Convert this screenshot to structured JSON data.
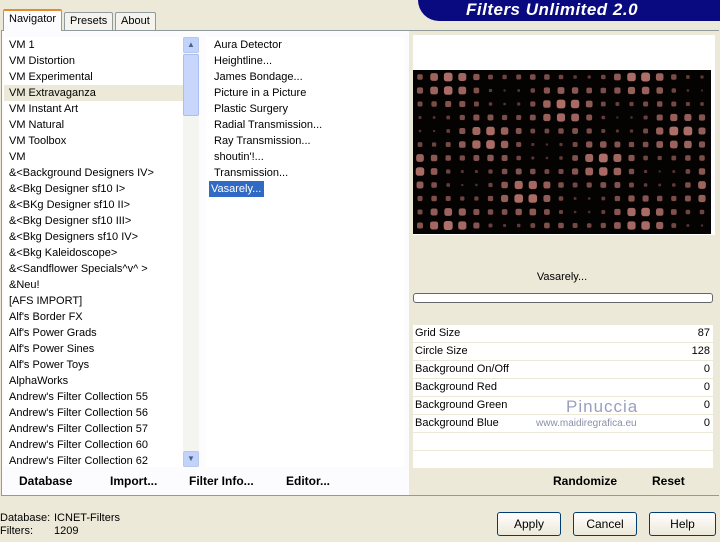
{
  "app_title": "Filters Unlimited 2.0",
  "tabs": [
    "Navigator",
    "Presets",
    "About"
  ],
  "categories": [
    "VM 1",
    "VM Distortion",
    "VM Experimental",
    "VM Extravaganza",
    "VM Instant Art",
    "VM Natural",
    "VM Toolbox",
    "VM",
    "&<Background Designers IV>",
    "&<Bkg Designer sf10 I>",
    "&<BKg Designer sf10 II>",
    "&<Bkg Designer sf10 III>",
    "&<Bkg Designers sf10 IV>",
    "&<Bkg Kaleidoscope>",
    "&<Sandflower Specials^v^ >",
    "&Neu!",
    "[AFS IMPORT]",
    "Alf's Border FX",
    "Alf's Power Grads",
    "Alf's Power Sines",
    "Alf's Power Toys",
    "AlphaWorks",
    "Andrew's Filter Collection 55",
    "Andrew's Filter Collection 56",
    "Andrew's Filter Collection 57",
    "Andrew's Filter Collection 60",
    "Andrew's Filter Collection 62"
  ],
  "selected_category": "VM Extravaganza",
  "filters": [
    " Aura Detector",
    "Heightline...",
    "James Bondage...",
    "Picture in a Picture",
    "Plastic Surgery",
    "Radial Transmission...",
    "Ray Transmission...",
    "shoutin'!...",
    "Transmission...",
    "Vasarely..."
  ],
  "selected_filter": "Vasarely...",
  "filter_name": "Vasarely...",
  "progress": 0,
  "params": [
    {
      "label": "Grid Size",
      "value": "87"
    },
    {
      "label": "Circle Size",
      "value": "128"
    },
    {
      "label": "Background On/Off",
      "value": "0"
    },
    {
      "label": "Background Red",
      "value": "0"
    },
    {
      "label": "Background Green",
      "value": "0"
    },
    {
      "label": "Background Blue",
      "value": "0"
    }
  ],
  "watermark": {
    "name": "Pinuccia",
    "url": "www.maidiregrafica.eu"
  },
  "bottom": {
    "database": "Database",
    "import": "Import...",
    "filter_info": "Filter Info...",
    "editor": "Editor...",
    "randomize": "Randomize",
    "reset": "Reset"
  },
  "status": {
    "database_label": "Database:",
    "database_value": "ICNET-Filters",
    "filters_label": "Filters:",
    "filters_value": "1209"
  },
  "buttons": {
    "apply": "Apply",
    "cancel": "Cancel",
    "help": "Help"
  },
  "colors": {
    "banner": "#0a0a80",
    "dot": "#b0706a",
    "selection": "#316ac5"
  }
}
